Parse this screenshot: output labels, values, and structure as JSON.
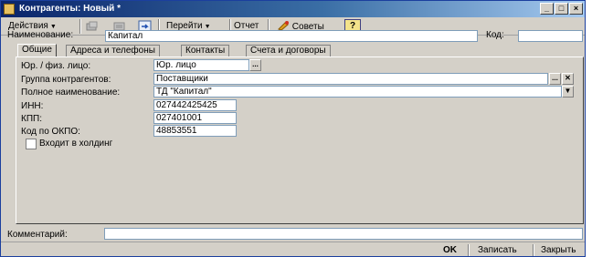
{
  "window": {
    "title": "Контрагенты: Новый *"
  },
  "toolbar": {
    "actions_label": "Действия",
    "goto_label": "Перейти",
    "report_label": "Отчет",
    "tips_label": "Советы",
    "help_label": "?"
  },
  "header": {
    "name_label": "Наименование:",
    "name_value": "Капитал",
    "code_label": "Код:",
    "code_value": ""
  },
  "tabs": [
    {
      "label": "Общие"
    },
    {
      "label": "Адреса и телефоны"
    },
    {
      "label": "Контакты"
    },
    {
      "label": "Счета и договоры"
    }
  ],
  "general": {
    "legal_label": "Юр. / физ. лицо:",
    "legal_value": "Юр. лицо",
    "group_label": "Группа контрагентов:",
    "group_value": "Поставщики",
    "fullname_label": "Полное наименование:",
    "fullname_value": "ТД \"Капитал\"",
    "inn_label": "ИНН:",
    "inn_value": "027442425425",
    "kpp_label": "КПП:",
    "kpp_value": "027401001",
    "okpo_label": "Код по ОКПО:",
    "okpo_value": "48853551",
    "holding_label": "Входит в холдинг",
    "holding_checked": false
  },
  "comment": {
    "label": "Комментарий:",
    "value": ""
  },
  "buttons": {
    "ok": "OK",
    "save": "Записать",
    "close": "Закрыть"
  }
}
